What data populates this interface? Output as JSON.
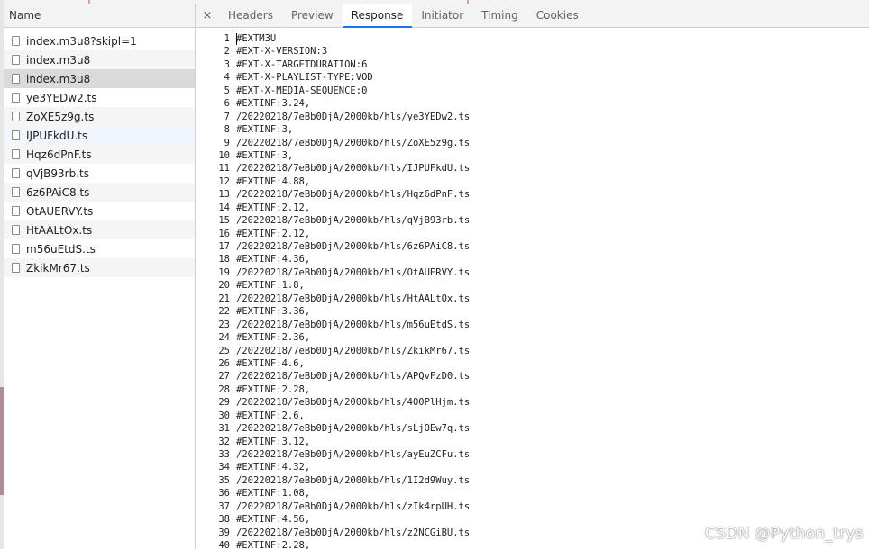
{
  "name_panel": {
    "header": "Name",
    "requests": [
      {
        "label": "index.m3u8?skipl=1",
        "state": "normal"
      },
      {
        "label": "index.m3u8",
        "state": "alt"
      },
      {
        "label": "index.m3u8",
        "state": "selected"
      },
      {
        "label": "ye3YEDw2.ts",
        "state": "normal"
      },
      {
        "label": "ZoXE5z9g.ts",
        "state": "alt"
      },
      {
        "label": "IJPUFkdU.ts",
        "state": "hover"
      },
      {
        "label": "Hqz6dPnF.ts",
        "state": "alt"
      },
      {
        "label": "qVjB93rb.ts",
        "state": "normal"
      },
      {
        "label": "6z6PAiC8.ts",
        "state": "alt"
      },
      {
        "label": "OtAUERVY.ts",
        "state": "normal"
      },
      {
        "label": "HtAALtOx.ts",
        "state": "alt"
      },
      {
        "label": "m56uEtdS.ts",
        "state": "normal"
      },
      {
        "label": "ZkikMr67.ts",
        "state": "alt"
      }
    ]
  },
  "detail_panel": {
    "close_label": "×",
    "tabs": [
      {
        "label": "Headers",
        "active": false
      },
      {
        "label": "Preview",
        "active": false
      },
      {
        "label": "Response",
        "active": true
      },
      {
        "label": "Initiator",
        "active": false
      },
      {
        "label": "Timing",
        "active": false
      },
      {
        "label": "Cookies",
        "active": false
      }
    ],
    "response_lines": [
      {
        "n": "1",
        "text": "#EXTM3U"
      },
      {
        "n": "2",
        "text": "#EXT-X-VERSION:3"
      },
      {
        "n": "3",
        "text": "#EXT-X-TARGETDURATION:6"
      },
      {
        "n": "4",
        "text": "#EXT-X-PLAYLIST-TYPE:VOD"
      },
      {
        "n": "5",
        "text": "#EXT-X-MEDIA-SEQUENCE:0"
      },
      {
        "n": "6",
        "text": "#EXTINF:3.24,"
      },
      {
        "n": "7",
        "text": "/20220218/7eBb0DjA/2000kb/hls/ye3YEDw2.ts"
      },
      {
        "n": "8",
        "text": "#EXTINF:3,"
      },
      {
        "n": "9",
        "text": "/20220218/7eBb0DjA/2000kb/hls/ZoXE5z9g.ts"
      },
      {
        "n": "10",
        "text": "#EXTINF:3,"
      },
      {
        "n": "11",
        "text": "/20220218/7eBb0DjA/2000kb/hls/IJPUFkdU.ts"
      },
      {
        "n": "12",
        "text": "#EXTINF:4.88,"
      },
      {
        "n": "13",
        "text": "/20220218/7eBb0DjA/2000kb/hls/Hqz6dPnF.ts"
      },
      {
        "n": "14",
        "text": "#EXTINF:2.12,"
      },
      {
        "n": "15",
        "text": "/20220218/7eBb0DjA/2000kb/hls/qVjB93rb.ts"
      },
      {
        "n": "16",
        "text": "#EXTINF:2.12,"
      },
      {
        "n": "17",
        "text": "/20220218/7eBb0DjA/2000kb/hls/6z6PAiC8.ts"
      },
      {
        "n": "18",
        "text": "#EXTINF:4.36,"
      },
      {
        "n": "19",
        "text": "/20220218/7eBb0DjA/2000kb/hls/OtAUERVY.ts"
      },
      {
        "n": "20",
        "text": "#EXTINF:1.8,"
      },
      {
        "n": "21",
        "text": "/20220218/7eBb0DjA/2000kb/hls/HtAALtOx.ts"
      },
      {
        "n": "22",
        "text": "#EXTINF:3.36,"
      },
      {
        "n": "23",
        "text": "/20220218/7eBb0DjA/2000kb/hls/m56uEtdS.ts"
      },
      {
        "n": "24",
        "text": "#EXTINF:2.36,"
      },
      {
        "n": "25",
        "text": "/20220218/7eBb0DjA/2000kb/hls/ZkikMr67.ts"
      },
      {
        "n": "26",
        "text": "#EXTINF:4.6,"
      },
      {
        "n": "27",
        "text": "/20220218/7eBb0DjA/2000kb/hls/APQvFzD0.ts"
      },
      {
        "n": "28",
        "text": "#EXTINF:2.28,"
      },
      {
        "n": "29",
        "text": "/20220218/7eBb0DjA/2000kb/hls/4O0PlHjm.ts"
      },
      {
        "n": "30",
        "text": "#EXTINF:2.6,"
      },
      {
        "n": "31",
        "text": "/20220218/7eBb0DjA/2000kb/hls/sLjOEw7q.ts"
      },
      {
        "n": "32",
        "text": "#EXTINF:3.12,"
      },
      {
        "n": "33",
        "text": "/20220218/7eBb0DjA/2000kb/hls/ayEuZCFu.ts"
      },
      {
        "n": "34",
        "text": "#EXTINF:4.32,"
      },
      {
        "n": "35",
        "text": "/20220218/7eBb0DjA/2000kb/hls/1I2d9Wuy.ts"
      },
      {
        "n": "36",
        "text": "#EXTINF:1.08,"
      },
      {
        "n": "37",
        "text": "/20220218/7eBb0DjA/2000kb/hls/zIk4rpUH.ts"
      },
      {
        "n": "38",
        "text": "#EXTINF:4.56,"
      },
      {
        "n": "39",
        "text": "/20220218/7eBb0DjA/2000kb/hls/z2NCGiBU.ts"
      },
      {
        "n": "40",
        "text": "#EXTINF:2.28,"
      }
    ]
  },
  "watermark": "CSDN @Python_trys",
  "colors": {
    "active_tab_underline": "#1a73e8",
    "selected_row": "#dadada",
    "alt_row": "#f5f5f5",
    "hover_row": "#f1f6fd"
  },
  "icons": {
    "request_row": "file-icon",
    "close": "close-icon"
  }
}
